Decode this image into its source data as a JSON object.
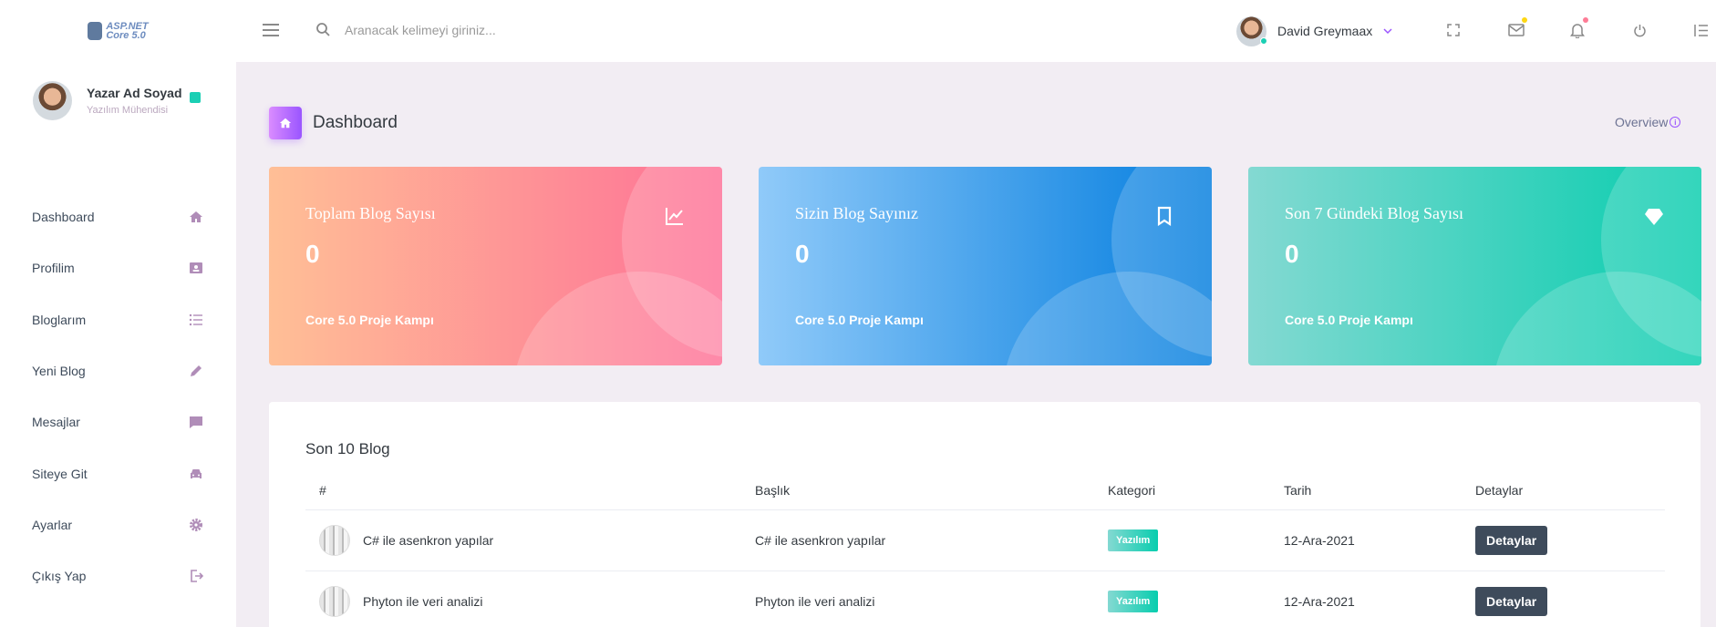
{
  "brand": {
    "logo_line1": "ASP.NET",
    "logo_line2": "Core 5.0"
  },
  "search": {
    "placeholder": "Aranacak kelimeyi giriniz..."
  },
  "user_menu": {
    "name": "David Greymaax"
  },
  "sidebar": {
    "profile": {
      "name": "Yazar Ad Soyad",
      "role": "Yazılım Mühendisi"
    },
    "items": [
      {
        "label": "Dashboard",
        "icon": "home-icon"
      },
      {
        "label": "Profilim",
        "icon": "contact-card-icon"
      },
      {
        "label": "Bloglarım",
        "icon": "list-icon"
      },
      {
        "label": "Yeni Blog",
        "icon": "pencil-icon"
      },
      {
        "label": "Mesajlar",
        "icon": "message-icon"
      },
      {
        "label": "Siteye Git",
        "icon": "car-icon"
      },
      {
        "label": "Ayarlar",
        "icon": "gear-icon"
      },
      {
        "label": "Çıkış Yap",
        "icon": "logout-icon"
      }
    ]
  },
  "page": {
    "title": "Dashboard",
    "overview_label": "Overview"
  },
  "cards": [
    {
      "title": "Toplam Blog Sayısı",
      "value": "0",
      "footer": "Core 5.0 Proje Kampı",
      "icon": "chart-line-icon"
    },
    {
      "title": "Sizin Blog Sayınız",
      "value": "0",
      "footer": "Core 5.0 Proje Kampı",
      "icon": "bookmark-icon"
    },
    {
      "title": "Son 7 Gündeki Blog Sayısı",
      "value": "0",
      "footer": "Core 5.0 Proje Kampı",
      "icon": "diamond-icon"
    }
  ],
  "table": {
    "title": "Son 10 Blog",
    "headers": [
      "#",
      "Başlık",
      "Kategori",
      "Tarih",
      "Detaylar"
    ],
    "rows": [
      {
        "name": "C# ile asenkron yapılar",
        "title": "C# ile asenkron yapılar",
        "category": "Yazılım",
        "date": "12-Ara-2021",
        "action": "Detaylar"
      },
      {
        "name": "Phyton ile veri analizi",
        "title": "Phyton ile veri analizi",
        "category": "Yazılım",
        "date": "12-Ara-2021",
        "action": "Detaylar"
      }
    ]
  },
  "colors": {
    "accent": "#9a55ff",
    "success": "#1bcfb4",
    "dark": "#3e4b5b",
    "sidebar_icon": "#b08db8"
  }
}
